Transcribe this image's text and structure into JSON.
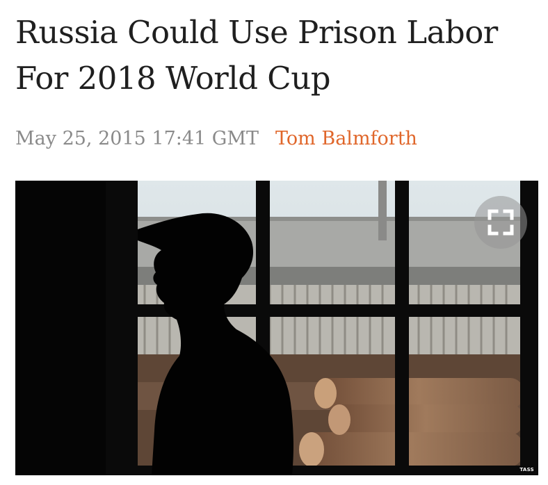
{
  "article": {
    "headline": "Russia Could Use Prison Labor For 2018 World Cup",
    "date": "May 25, 2015 17:41 GMT",
    "author": "Tom Balmforth"
  },
  "photo": {
    "credit": "TASS",
    "expand_icon": "fullscreen-expand-icon"
  },
  "colors": {
    "author_accent": "#e0662a",
    "date_gray": "#8a8a8a",
    "headline": "#1f1f1f"
  }
}
